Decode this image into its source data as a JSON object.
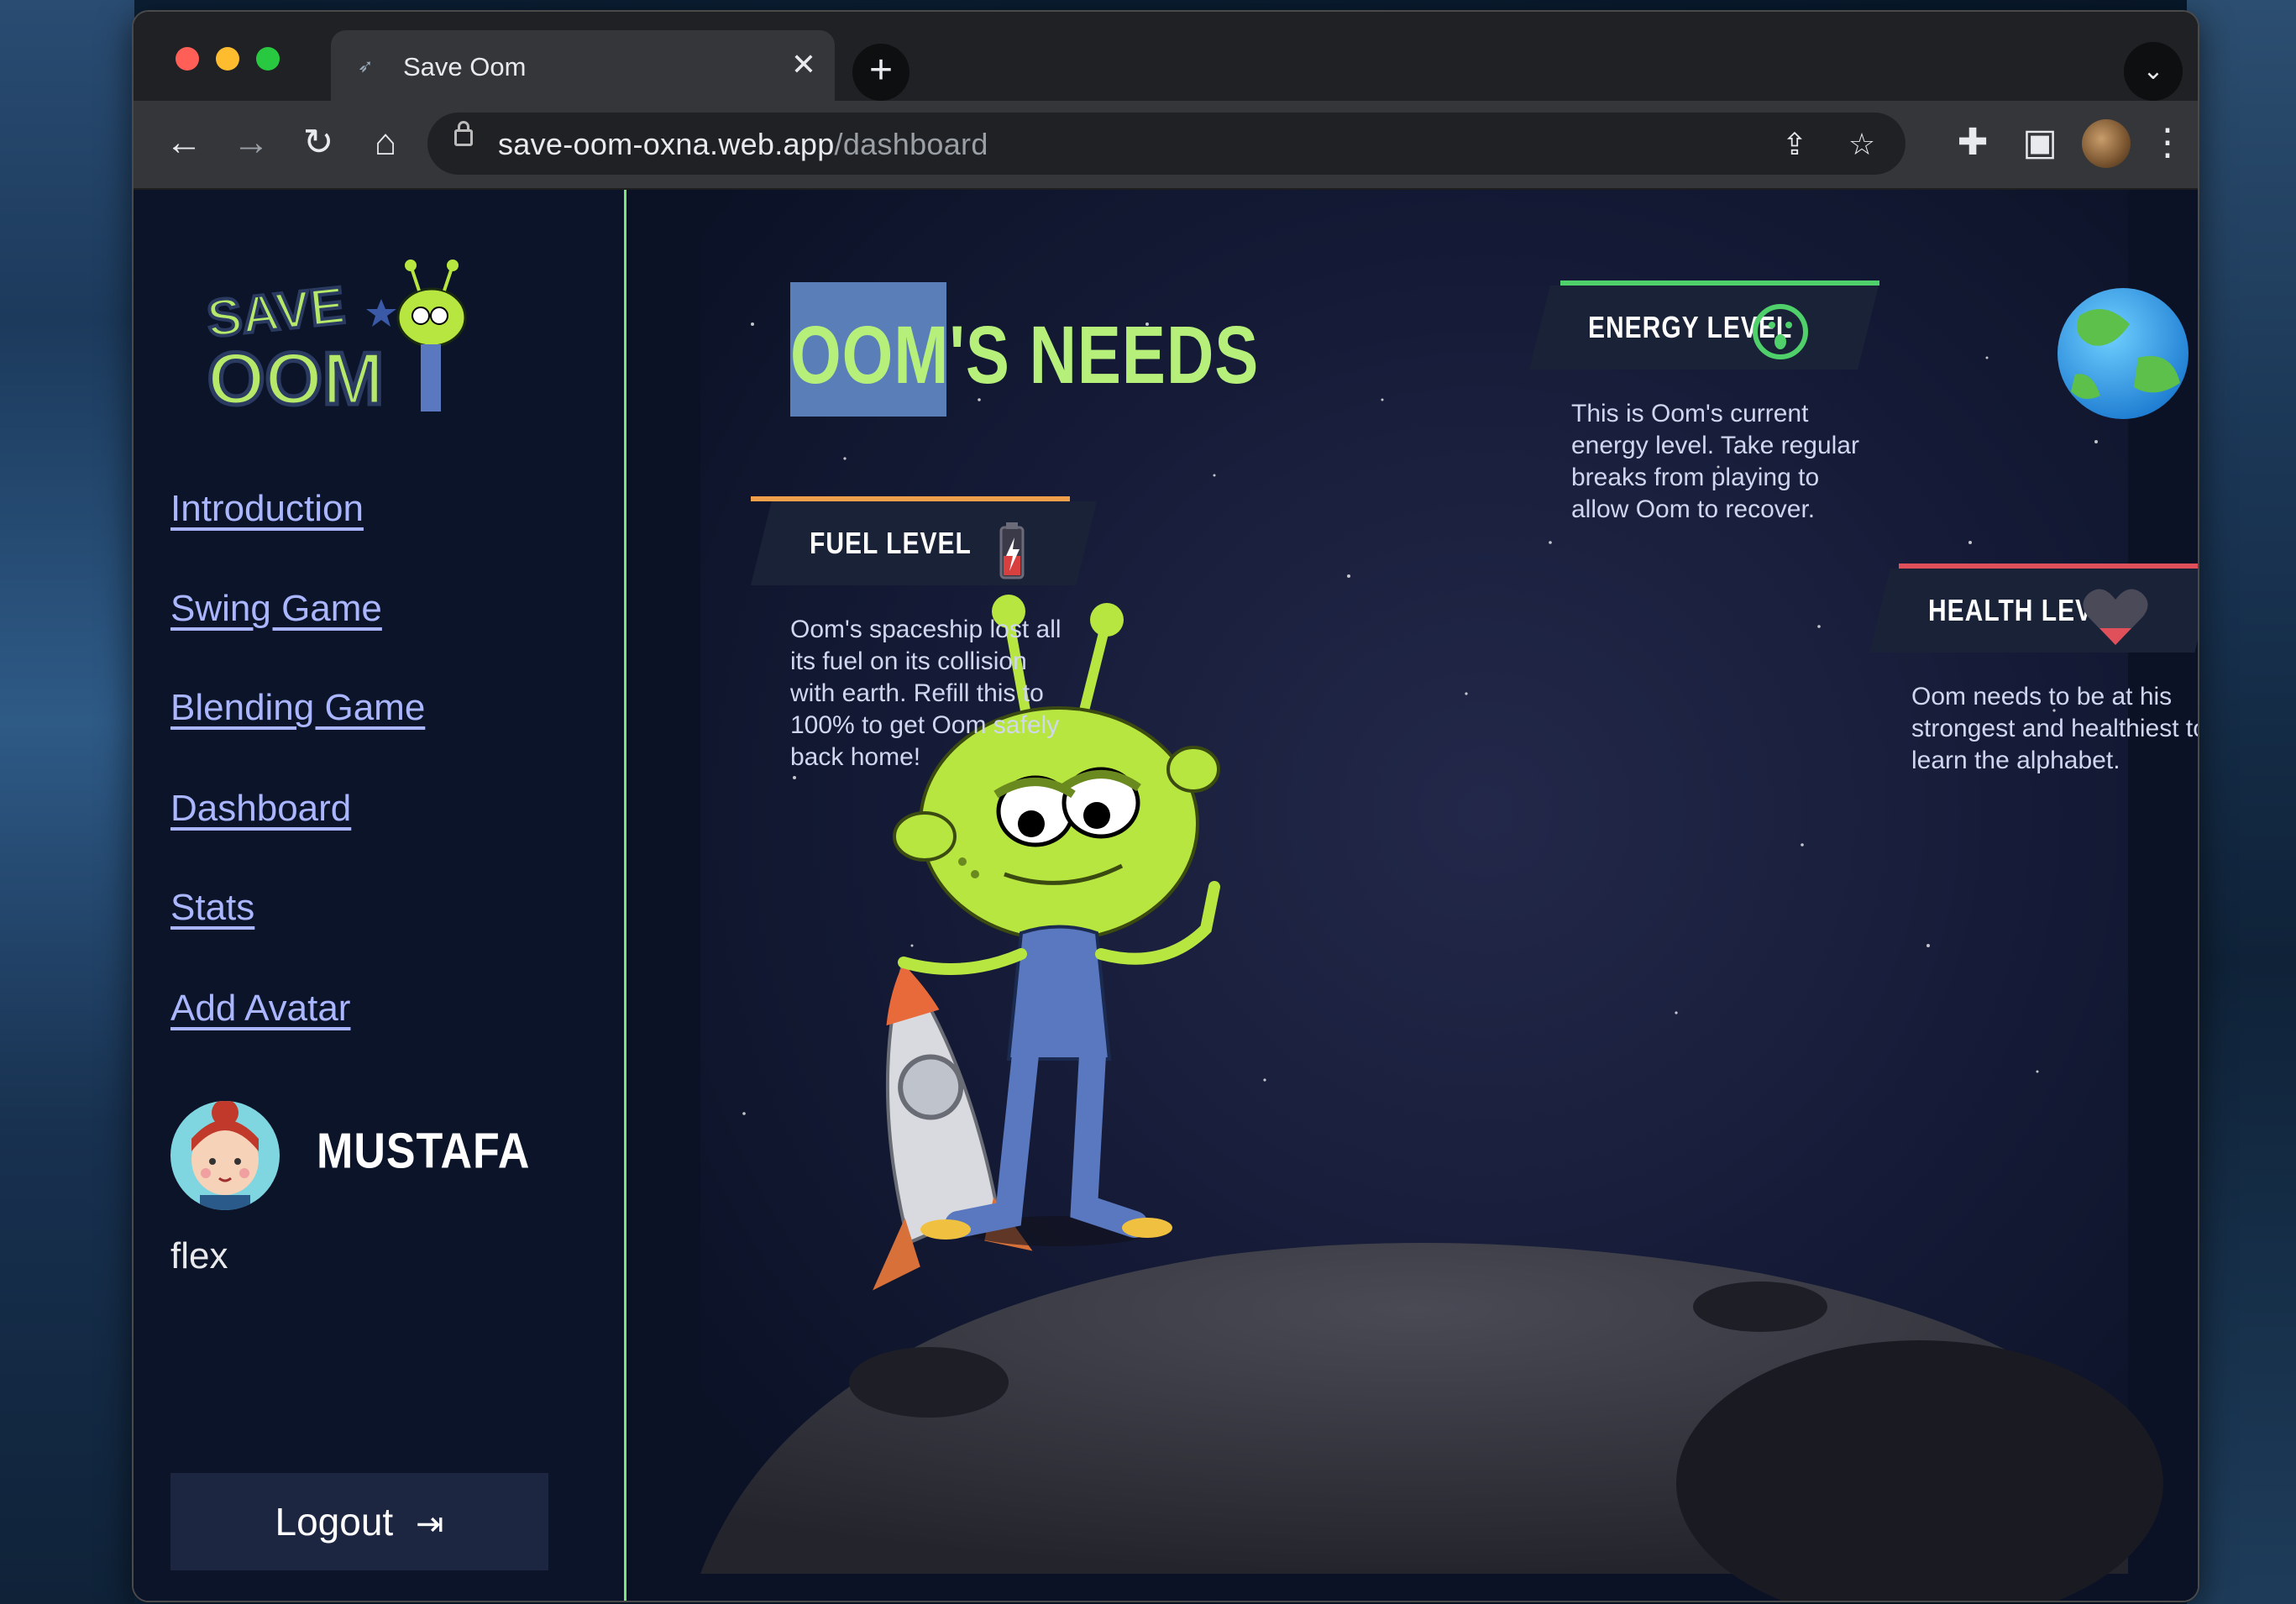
{
  "browser": {
    "tab_title": "Save Oom",
    "url_domain": "save-oom-oxna.web.app",
    "url_path": "/dashboard"
  },
  "sidebar": {
    "logo_text": "SAVE OOM",
    "nav": [
      {
        "label": "Introduction"
      },
      {
        "label": "Swing Game"
      },
      {
        "label": "Blending Game"
      },
      {
        "label": "Dashboard"
      },
      {
        "label": "Stats"
      },
      {
        "label": "Add Avatar"
      }
    ],
    "user": {
      "name": "MUSTAFA",
      "subtitle": "flex"
    },
    "logout_label": "Logout"
  },
  "main": {
    "heading_part1": "OOM'S",
    "heading_part2": "NEEDS",
    "fuel": {
      "label": "FUEL LEVEL",
      "description": "Oom's spaceship lost all its fuel on its collision with earth. Refill this to 100% to get Oom safely back home!",
      "accent": "#f0a04a"
    },
    "energy": {
      "label": "ENERGY LEVEL",
      "description": "This is Oom's current energy level. Take regular breaks from playing to allow Oom to recover.",
      "accent": "#4fd06a"
    },
    "health": {
      "label": "HEALTH LEVEL",
      "description": "Oom needs to be at his strongest and healthiest to learn the alphabet.",
      "accent": "#e0505a"
    }
  },
  "colors": {
    "accent_green": "#7fe37a",
    "heading_green": "#b6f07a",
    "link": "#aab6ff",
    "sidebar_bg": "#0c1429"
  }
}
